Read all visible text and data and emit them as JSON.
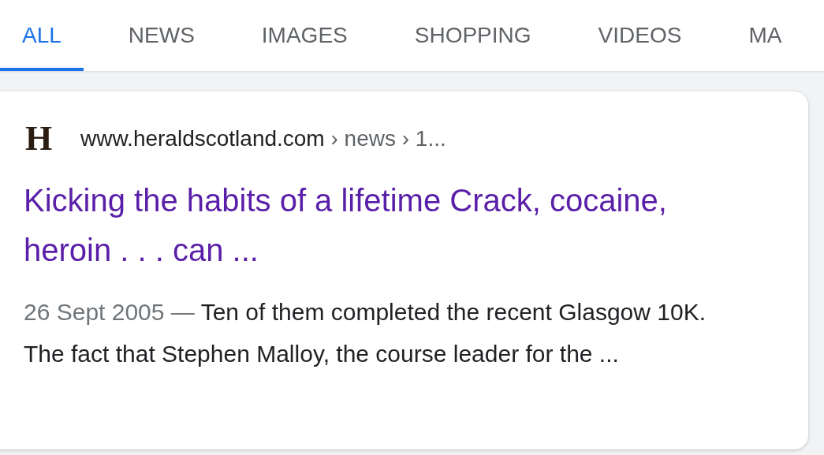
{
  "tabs": [
    {
      "label": "ALL",
      "selected": true
    },
    {
      "label": "NEWS",
      "selected": false
    },
    {
      "label": "IMAGES",
      "selected": false
    },
    {
      "label": "SHOPPING",
      "selected": false
    },
    {
      "label": "VIDEOS",
      "selected": false
    },
    {
      "label": "MA",
      "selected": false
    }
  ],
  "result": {
    "favicon": "H",
    "site": "www.heraldscotland.com",
    "path": " › news › 1...",
    "title": "Kicking the habits of a lifetime Crack, cocaine, heroin . . . can ...",
    "date": "26 Sept 2005 — ",
    "snippet": "Ten of them completed the recent Glasgow 10K. The fact that Stephen Malloy, the course leader for the ..."
  }
}
